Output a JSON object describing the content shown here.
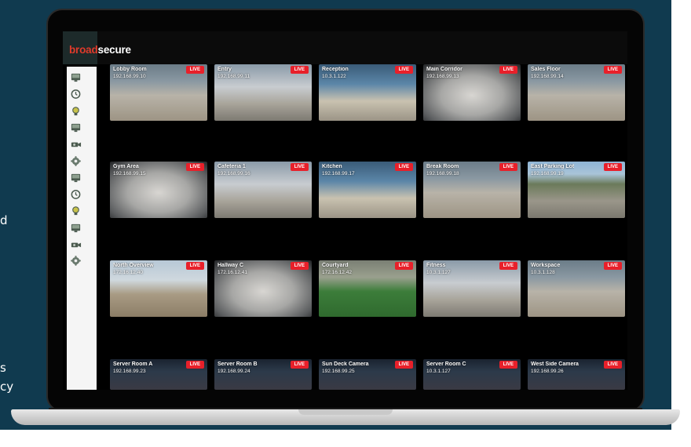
{
  "page": {
    "side_fragments": [
      "d",
      "s",
      "cy"
    ],
    "colors": {
      "background": "#103a4f",
      "live_badge": "#e8202a",
      "brand_red": "#e03a2a"
    }
  },
  "app": {
    "brand_part1": "broad",
    "brand_part2": "secure"
  },
  "sidebar": {
    "items": [
      {
        "icon": "monitor-icon"
      },
      {
        "icon": "alarm-clock-icon"
      },
      {
        "icon": "lightbulb-icon"
      },
      {
        "icon": "monitor-icon"
      },
      {
        "icon": "camera-icon"
      },
      {
        "icon": "settings-gear-icon"
      },
      {
        "icon": "monitor-icon"
      },
      {
        "icon": "alarm-clock-icon"
      },
      {
        "icon": "lightbulb-icon"
      },
      {
        "icon": "monitor-icon"
      },
      {
        "icon": "camera-icon"
      },
      {
        "icon": "settings-gear-icon"
      }
    ]
  },
  "cameras": [
    {
      "name": "Lobby Room",
      "ip": "192.168.99.10",
      "live": "LIVE",
      "scene": "office"
    },
    {
      "name": "Entry",
      "ip": "192.168.99.11",
      "live": "LIVE",
      "scene": "hall"
    },
    {
      "name": "Reception",
      "ip": "10.3.1.122",
      "live": "LIVE",
      "scene": "reception"
    },
    {
      "name": "Main Corridor",
      "ip": "192.168.99.13",
      "live": "LIVE",
      "scene": "fisheye"
    },
    {
      "name": "Sales Floor",
      "ip": "192.168.99.14",
      "live": "LIVE",
      "scene": "office"
    },
    {
      "name": "Gym Area",
      "ip": "192.168.99.15",
      "live": "LIVE",
      "scene": "fisheye"
    },
    {
      "name": "Cafeteria 1",
      "ip": "192.168.99.16",
      "live": "LIVE",
      "scene": "hall"
    },
    {
      "name": "Kitchen",
      "ip": "192.168.99.17",
      "live": "LIVE",
      "scene": "reception"
    },
    {
      "name": "Break Room",
      "ip": "192.168.99.18",
      "live": "LIVE",
      "scene": "office"
    },
    {
      "name": "East Parking Lot",
      "ip": "192.168.99.19",
      "live": "LIVE",
      "scene": "parking"
    },
    {
      "name": "North Overview",
      "ip": "172.16.12.40",
      "live": "LIVE",
      "scene": "skyline"
    },
    {
      "name": "Hallway C",
      "ip": "172.16.12.41",
      "live": "LIVE",
      "scene": "fisheye"
    },
    {
      "name": "Courtyard",
      "ip": "172.16.12.42",
      "live": "LIVE",
      "scene": "field"
    },
    {
      "name": "Fitness",
      "ip": "10.3.1.127",
      "live": "LIVE",
      "scene": "hall"
    },
    {
      "name": "Workspace",
      "ip": "10.3.1.128",
      "live": "LIVE",
      "scene": "office"
    },
    {
      "name": "Server Room A",
      "ip": "192.168.99.23",
      "live": "LIVE",
      "scene": "dark"
    },
    {
      "name": "Server Room B",
      "ip": "192.168.99.24",
      "live": "LIVE",
      "scene": "dark"
    },
    {
      "name": "Sun Deck Camera",
      "ip": "192.168.99.25",
      "live": "LIVE",
      "scene": "dark"
    },
    {
      "name": "Server Room C",
      "ip": "10.3.1.127",
      "live": "LIVE",
      "scene": "dark"
    },
    {
      "name": "West Side Camera",
      "ip": "192.168.99.26",
      "live": "LIVE",
      "scene": "dark"
    }
  ]
}
